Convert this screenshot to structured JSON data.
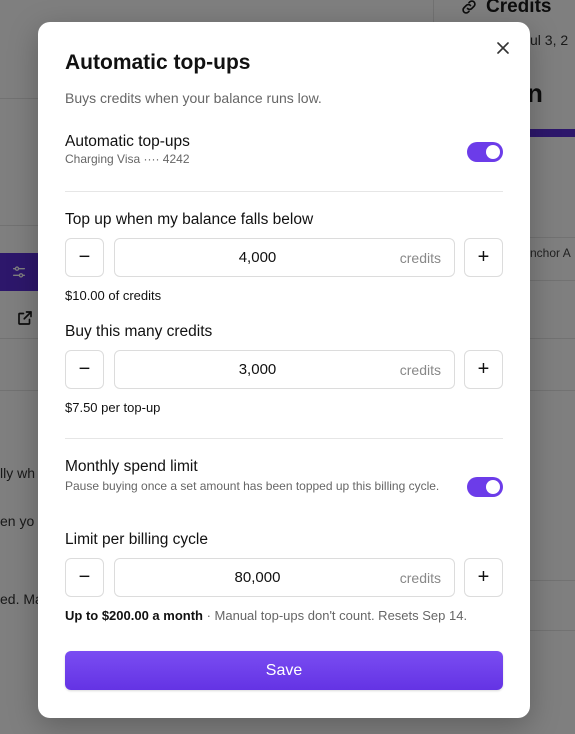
{
  "background": {
    "section_title": "Credits",
    "date_fragment": "ul 3, 2",
    "big_letter": "n",
    "anchor_fragment": "nchor A",
    "text_fragment_1": "lly wh",
    "text_fragment_2": "en yo",
    "text_fragment_3": "ed. Ma"
  },
  "modal": {
    "title": "Automatic top-ups",
    "subtitle": "Buys credits when your balance runs low.",
    "close_icon": "close-icon",
    "auto_topups": {
      "label": "Automatic top-ups",
      "sub": "Charging Visa ···· 4242",
      "enabled": true
    },
    "threshold": {
      "label": "Top up when my balance falls below",
      "value": "4,000",
      "unit": "credits",
      "note": "$10.00 of credits"
    },
    "buy_amount": {
      "label": "Buy this many credits",
      "value": "3,000",
      "unit": "credits",
      "note": "$7.50 per top-up"
    },
    "monthly_limit": {
      "label": "Monthly spend limit",
      "sub": "Pause buying once a set amount has been topped up this billing cycle.",
      "enabled": true
    },
    "cycle_limit": {
      "label": "Limit per billing cycle",
      "value": "80,000",
      "unit": "credits",
      "note_bold": "Up to $200.00 a month",
      "note_rest": " · Manual top-ups don't count. Resets Sep 14."
    },
    "minus_label": "−",
    "plus_label": "+",
    "save_label": "Save"
  },
  "colors": {
    "accent": "#6c3ce9",
    "overlay": "#7f7f7f"
  }
}
